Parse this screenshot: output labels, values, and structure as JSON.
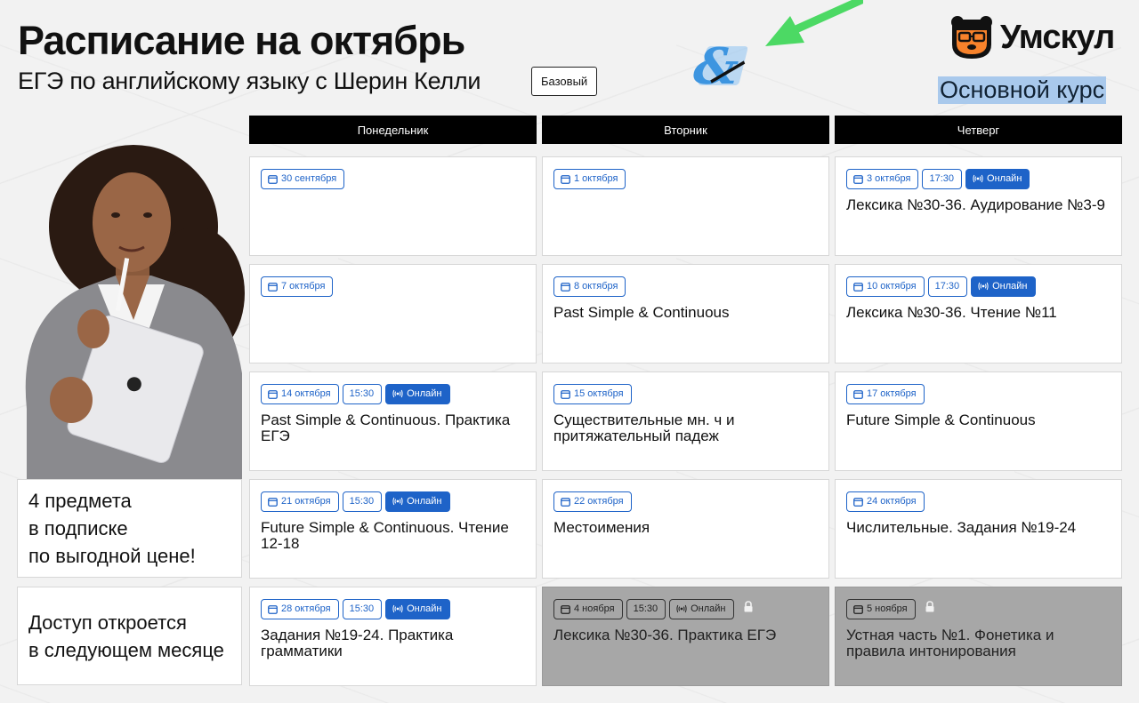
{
  "header": {
    "title": "Расписание на октябрь",
    "subtitle": "ЕГЭ по английскому языку с Шерин Келли",
    "tier_badge": "Базовый",
    "brand_name": "Умскул",
    "course_label": "Основной курс"
  },
  "days": [
    "Понедельник",
    "Вторник",
    "Четверг"
  ],
  "colors": {
    "accent": "#1e63c8",
    "highlight": "#a9c9ec",
    "arrow": "#4cd964",
    "locked": "#a7a7a7"
  },
  "promos": {
    "subscription": [
      "4 предмета",
      "в подписке",
      "по выгодной цене!"
    ],
    "access": [
      "Доступ откроется",
      "в следующем месяце"
    ]
  },
  "schedule": [
    [
      {
        "date": "30 сентября",
        "title": ""
      },
      {
        "date": "1 октября",
        "title": ""
      },
      {
        "date": "3 октября",
        "time": "17:30",
        "online": "Онлайн",
        "title": "Лексика №30-36. Аудирование №3-9"
      }
    ],
    [
      {
        "date": "7 октября",
        "title": ""
      },
      {
        "date": "8 октября",
        "title": "Past Simple & Continuous"
      },
      {
        "date": "10 октября",
        "time": "17:30",
        "online": "Онлайн",
        "title": "Лексика №30-36. Чтение №11"
      }
    ],
    [
      {
        "date": "14 октября",
        "time": "15:30",
        "online": "Онлайн",
        "title": "Past Simple & Continuous. Практика ЕГЭ"
      },
      {
        "date": "15 октября",
        "title": "Существительные мн. ч и притяжательный падеж"
      },
      {
        "date": "17 октября",
        "title": "Future Simple & Continuous"
      }
    ],
    [
      {
        "date": "21 октября",
        "time": "15:30",
        "online": "Онлайн",
        "title": "Future Simple & Continuous. Чтение 12-18"
      },
      {
        "date": "22 октября",
        "title": "Местоимения"
      },
      {
        "date": "24 октября",
        "title": "Числительные. Задания №19-24"
      }
    ],
    [
      {
        "date": "28 октября",
        "time": "15:30",
        "online": "Онлайн",
        "title": "Задания №19-24. Практика грамматики"
      },
      {
        "date": "4 ноября",
        "time": "15:30",
        "online": "Онлайн",
        "title": "Лексика №30-36. Практика ЕГЭ",
        "locked": true
      },
      {
        "date": "5 ноября",
        "title": "Устная часть №1. Фонетика и правила интонирования",
        "locked": true
      }
    ]
  ]
}
